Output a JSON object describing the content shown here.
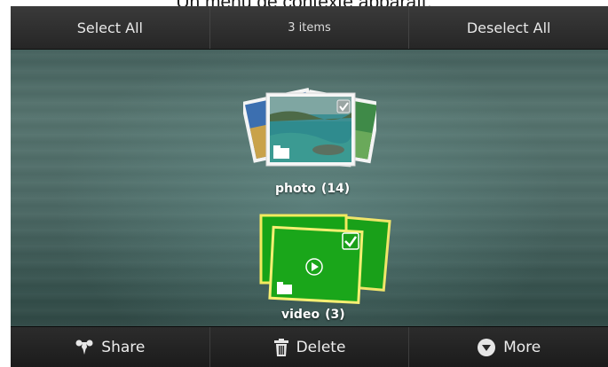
{
  "caption": "Un menu de contexte apparaît.",
  "topbar": {
    "select_all": "Select All",
    "item_count": "3 items",
    "deselect_all": "Deselect All"
  },
  "albums": [
    {
      "name": "photo",
      "count": "(14)",
      "selected": true,
      "folder_icon": "folder-icon",
      "check_icon": "checkmark-icon"
    },
    {
      "name": "video",
      "count": "(3)",
      "selected": true,
      "folder_icon": "folder-icon",
      "play_icon": "play-icon",
      "check_icon": "checkmark-icon",
      "highlight_color": "#1aa01a"
    }
  ],
  "actions": {
    "share": {
      "label": "Share",
      "icon": "share-icon"
    },
    "delete": {
      "label": "Delete",
      "icon": "trash-icon"
    },
    "more": {
      "label": "More",
      "icon": "more-icon"
    }
  }
}
